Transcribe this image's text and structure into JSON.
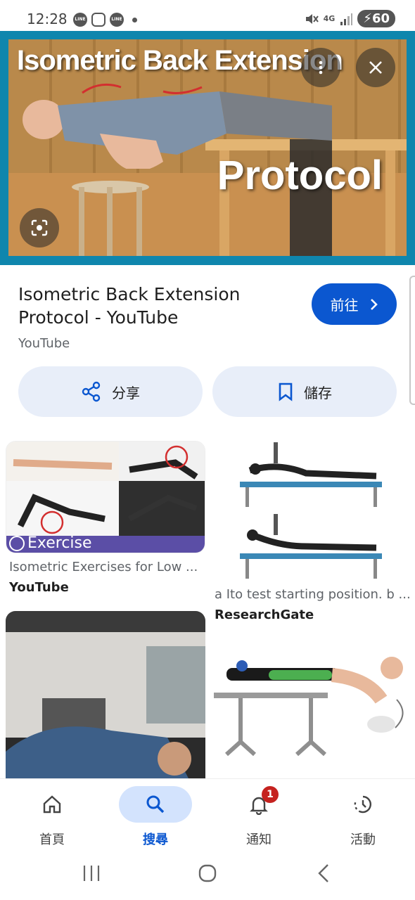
{
  "status_bar": {
    "time": "12:28",
    "apps": [
      "LINE",
      "instagram-icon",
      "LINE"
    ],
    "network": "4G",
    "battery": "60"
  },
  "hero": {
    "image_title": "Isometric Back Extension",
    "image_subtitle": "Protocol"
  },
  "result": {
    "title": "Isometric Back Extension Protocol - YouTube",
    "source": "YouTube",
    "goto_label": "前往",
    "share_label": "分享",
    "save_label": "儲存"
  },
  "grid": [
    {
      "caption": "Isometric Exercises for Low ...",
      "source": "YouTube",
      "badge": "Exercise"
    },
    {
      "caption": "a Ito test starting position. b ...",
      "source": "ResearchGate"
    },
    {
      "caption": "",
      "source": ""
    },
    {
      "caption": "",
      "source": ""
    }
  ],
  "bottom_nav": {
    "items": [
      {
        "label": "首頁"
      },
      {
        "label": "搜尋"
      },
      {
        "label": "通知",
        "badge": "1"
      },
      {
        "label": "活動"
      }
    ]
  },
  "colors": {
    "accent": "#0b57d0",
    "pill_bg": "#e8eef9",
    "hero_frame": "#0f86ad",
    "badge": "#c5221f"
  }
}
